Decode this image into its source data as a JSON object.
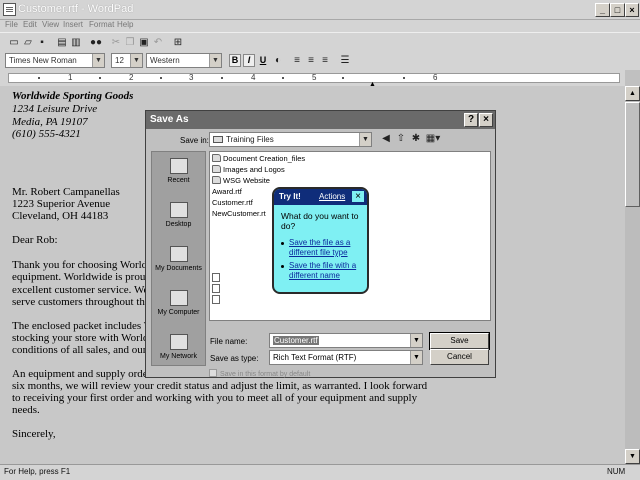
{
  "window": {
    "title": "Customer.rtf - WordPad",
    "minimize": "_",
    "maximize": "□",
    "close": "×"
  },
  "menu": [
    "File",
    "Edit",
    "View",
    "Insert",
    "Format",
    "Help"
  ],
  "format_bar": {
    "font": "Times New Roman",
    "size": "12",
    "script": "Western",
    "bold": "B",
    "italic": "I",
    "underline": "U"
  },
  "ruler_marks": [
    "1",
    "2",
    "3",
    "4",
    "5",
    "6"
  ],
  "document": {
    "lines": [
      "Worldwide Sporting Goods",
      "1234 Leisure Drive",
      "Media, PA 19107",
      "(610) 555-4321",
      "Mr. Robert Campanellas",
      "1223 Superior Avenue",
      "Cleveland, OH  44183",
      "Dear Rob:",
      "Thank you for choosing Worldwide",
      "equipment. Worldwide is proud of",
      "excellent customer service. We hav",
      "serve customers throughout the Uni",
      "The enclosed packet includes Work",
      "stocking your store with Worldwide",
      "conditions of all sales, and our adv",
      "An equipment and supply order for",
      "six months, we will review your credit status and adjust the limit, as warranted. I look forward",
      "to receiving your first order and working with you to meet all of your equipment and supply",
      "needs.",
      "Sincerely,"
    ]
  },
  "status": {
    "help": "For Help, press F1",
    "num": "NUM"
  },
  "save_dialog": {
    "title": "Save As",
    "help_btn": "?",
    "close_btn": "×",
    "save_in_label": "Save in:",
    "save_in_value": "Training Files",
    "places": [
      "Recent",
      "Desktop",
      "My Documents",
      "My Computer",
      "My Network"
    ],
    "files": [
      {
        "name": "Document Creation_files",
        "kind": "folder"
      },
      {
        "name": "Images and Logos",
        "kind": "folder"
      },
      {
        "name": "WSG Website",
        "kind": "folder"
      },
      {
        "name": "Award.rtf",
        "kind": "doc"
      },
      {
        "name": "Customer.rtf",
        "kind": "doc"
      },
      {
        "name": "NewCustomer.rt",
        "kind": "doc"
      }
    ],
    "file_name_label": "File name:",
    "file_name_value": "Customer.rtf",
    "save_as_type_label": "Save as type:",
    "save_as_type_value": "Rich Text Format (RTF)",
    "save_button": "Save",
    "cancel_button": "Cancel",
    "default_format_checkbox": "Save in this format by default"
  },
  "try_it": {
    "title": "Try It!",
    "actions": "Actions",
    "close": "×",
    "question": "What do you want to do?",
    "options": [
      "Save the file as a different file type",
      "Save the file with a different name"
    ]
  }
}
